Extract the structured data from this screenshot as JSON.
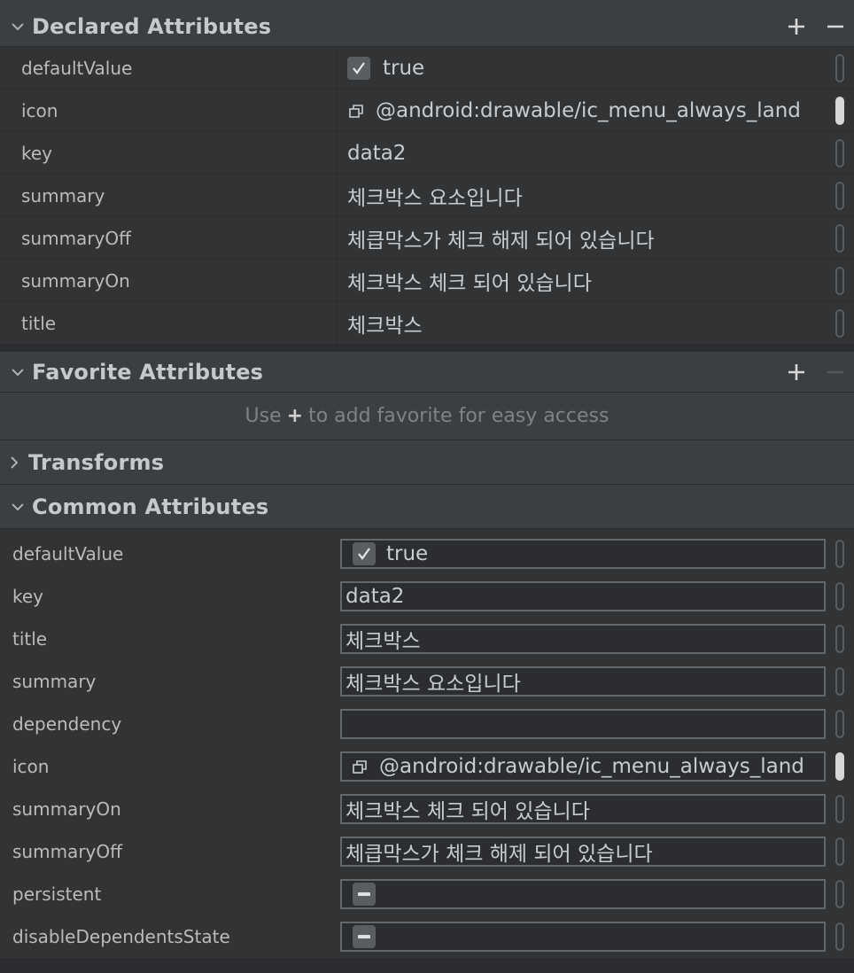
{
  "declared": {
    "title": "Declared Attributes",
    "rows": [
      {
        "name": "defaultValue",
        "value": "true"
      },
      {
        "name": "icon",
        "value": "@android:drawable/ic_menu_always_land"
      },
      {
        "name": "key",
        "value": "data2"
      },
      {
        "name": "summary",
        "value": "체크박스 요소입니다"
      },
      {
        "name": "summaryOff",
        "value": "체큽막스가 체크 해제 되어 있습니다"
      },
      {
        "name": "summaryOn",
        "value": "체크박스 체크 되어 있습니다"
      },
      {
        "name": "title",
        "value": "체크박스"
      }
    ]
  },
  "favorite": {
    "title": "Favorite Attributes",
    "hint_prefix": "Use",
    "hint_plus": "+",
    "hint_suffix": "to add favorite for easy access"
  },
  "transforms": {
    "title": "Transforms"
  },
  "common": {
    "title": "Common Attributes",
    "rows": [
      {
        "name": "defaultValue",
        "value": "true"
      },
      {
        "name": "key",
        "value": "data2"
      },
      {
        "name": "title",
        "value": "체크박스"
      },
      {
        "name": "summary",
        "value": "체크박스 요소입니다"
      },
      {
        "name": "dependency",
        "value": ""
      },
      {
        "name": "icon",
        "value": "@android:drawable/ic_menu_always_land"
      },
      {
        "name": "summaryOn",
        "value": "체크박스 체크 되어 있습니다"
      },
      {
        "name": "summaryOff",
        "value": "체큽막스가 체크 해제 되어 있습니다"
      },
      {
        "name": "persistent",
        "value": ""
      },
      {
        "name": "disableDependentsState",
        "value": ""
      }
    ]
  },
  "icons": {
    "expanded": "chevron-down-icon",
    "collapsed": "chevron-right-icon",
    "add": "plus-icon",
    "remove": "minus-icon",
    "check": "checkmark-icon",
    "resource": "resource-reference-icon"
  },
  "colors": {
    "header_bg": "#3c3f41",
    "row_bg": "#313335",
    "panel_bg": "#2b2d30",
    "text": "#bbbbbb"
  }
}
